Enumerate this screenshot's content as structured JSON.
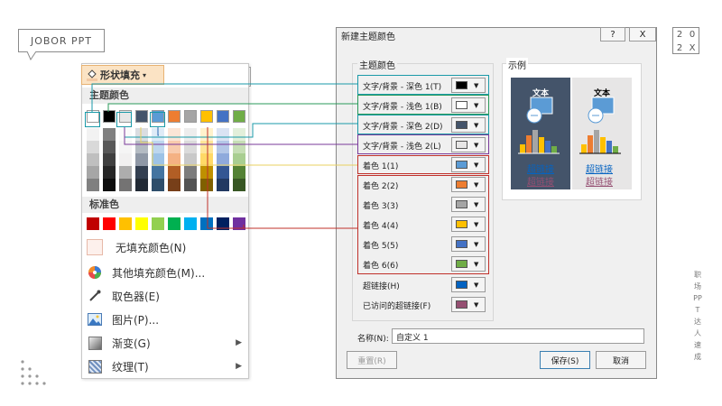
{
  "brand": {
    "logo_text": "JOBOR PPT",
    "year_digits": [
      "2",
      "0",
      "2",
      "X"
    ],
    "side_text": "职场PPT达人速成"
  },
  "menu": {
    "button_label": "形状填充",
    "theme_header": "主题颜色",
    "standard_header": "标准色",
    "theme_colors": [
      "#ffffff",
      "#000000",
      "#e7e6e6",
      "#44546a",
      "#5b9bd5",
      "#ed7d31",
      "#a5a5a5",
      "#ffc000",
      "#4472c4",
      "#70ad47"
    ],
    "standard_colors": [
      "#c00000",
      "#ff0000",
      "#ffc000",
      "#ffff00",
      "#92d050",
      "#00b050",
      "#00b0f0",
      "#0070c0",
      "#002060",
      "#7030a0"
    ],
    "items": [
      {
        "label": "无填充颜色(N)",
        "icon": "no-fill-icon"
      },
      {
        "label": "其他填充颜色(M)...",
        "icon": "color-wheel-icon"
      },
      {
        "label": "取色器(E)",
        "icon": "eyedropper-icon"
      },
      {
        "label": "图片(P)...",
        "icon": "picture-icon"
      },
      {
        "label": "渐变(G)",
        "icon": "gradient-icon",
        "submenu": true
      },
      {
        "label": "纹理(T)",
        "icon": "texture-icon",
        "submenu": true
      }
    ]
  },
  "dialog": {
    "title": "新建主题颜色",
    "help": "?",
    "close": "X",
    "group_title": "主题颜色",
    "preview_title": "示例",
    "rows": [
      {
        "label": "文字/背景 - 深色 1(T)",
        "color": "#000000"
      },
      {
        "label": "文字/背景 - 浅色 1(B)",
        "color": "#ffffff"
      },
      {
        "label": "文字/背景 - 深色 2(D)",
        "color": "#44546a"
      },
      {
        "label": "文字/背景 - 浅色 2(L)",
        "color": "#e7e6e6"
      },
      {
        "label": "着色 1(1)",
        "color": "#5b9bd5"
      },
      {
        "label": "着色 2(2)",
        "color": "#ed7d31"
      },
      {
        "label": "着色 3(3)",
        "color": "#a5a5a5"
      },
      {
        "label": "着色 4(4)",
        "color": "#ffc000"
      },
      {
        "label": "着色 5(5)",
        "color": "#4472c4"
      },
      {
        "label": "着色 6(6)",
        "color": "#70ad47"
      },
      {
        "label": "超链接(H)",
        "color": "#0563c1"
      },
      {
        "label": "已访问的超链接(F)",
        "color": "#954f72"
      }
    ],
    "preview": {
      "text_label": "文本",
      "hyperlink": "超链接",
      "visited": "超链接"
    },
    "name_label": "名称(N):",
    "name_value": "自定义 1",
    "reset_label": "重置(R)",
    "save_label": "保存(S)",
    "cancel_label": "取消"
  },
  "accents": {
    "teal": "#1a9aa8",
    "green": "#2a9a5a",
    "purple": "#7a3a9a",
    "yellow": "#e8d060",
    "red": "#c0302a",
    "blue": "#2a6ab0"
  }
}
